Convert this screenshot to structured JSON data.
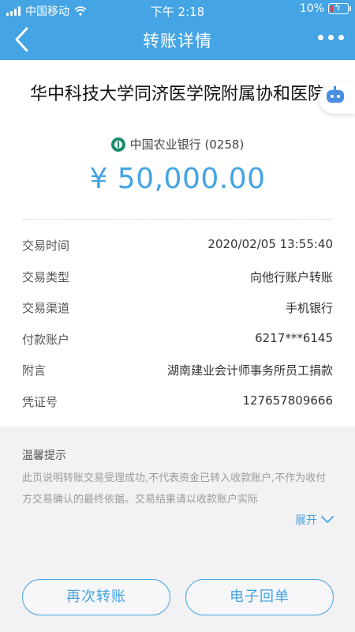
{
  "status_bar": {
    "carrier": "中国移动",
    "time": "下午 2:18",
    "battery": "10%"
  },
  "nav": {
    "title": "转账详情"
  },
  "transfer": {
    "payee_name": "华中科技大学同济医学院附属协和医院",
    "bank": "中国农业银行 (0258)",
    "amount": "¥ 50,000.00"
  },
  "details": [
    {
      "label": "交易时间",
      "value": "2020/02/05 13:55:40"
    },
    {
      "label": "交易类型",
      "value": "向他行账户转账"
    },
    {
      "label": "交易渠道",
      "value": "手机银行"
    },
    {
      "label": "付款账户",
      "value": "6217***6145"
    },
    {
      "label": "附言",
      "value": "湖南建业会计师事务所员工捐款"
    },
    {
      "label": "凭证号",
      "value": "127657809666"
    }
  ],
  "tips": {
    "title": "温馨提示",
    "text": "此页说明转账交易受理成功,不代表资金已转入收款账户,不作为收付方交易确认的最终依据。交易结果请以收款账户实际",
    "expand_label": "展开"
  },
  "buttons": {
    "transfer_again": "再次转账",
    "e_receipt": "电子回单"
  },
  "colors": {
    "accent": "#44a4e4",
    "bank_green": "#1b8e6b"
  }
}
